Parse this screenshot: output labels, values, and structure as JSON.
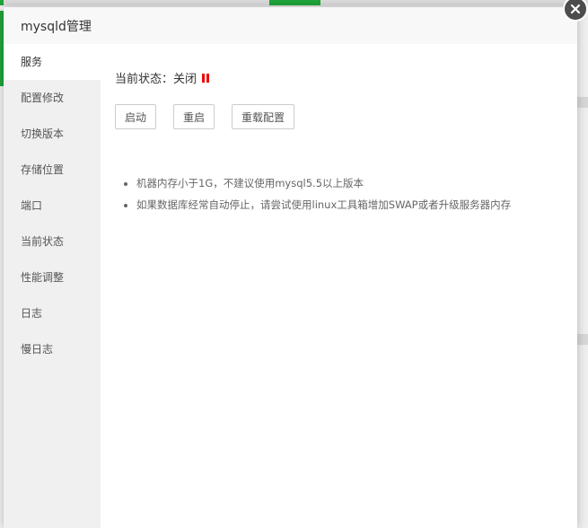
{
  "dialog": {
    "title": "mysqld管理"
  },
  "sidebar": {
    "items": [
      {
        "label": "服务",
        "active": true
      },
      {
        "label": "配置修改"
      },
      {
        "label": "切换版本"
      },
      {
        "label": "存储位置"
      },
      {
        "label": "端口"
      },
      {
        "label": "当前状态"
      },
      {
        "label": "性能调整"
      },
      {
        "label": "日志"
      },
      {
        "label": "慢日志"
      }
    ]
  },
  "service": {
    "status_label": "当前状态：关闭",
    "status_color": "#ef0808",
    "buttons": {
      "start": "启动",
      "restart": "重启",
      "reload": "重载配置"
    },
    "tips": [
      "机器内存小于1G，不建议使用mysql5.5以上版本",
      "如果数据库经常自动停止，请尝试使用linux工具箱增加SWAP或者升级服务器内存"
    ]
  }
}
